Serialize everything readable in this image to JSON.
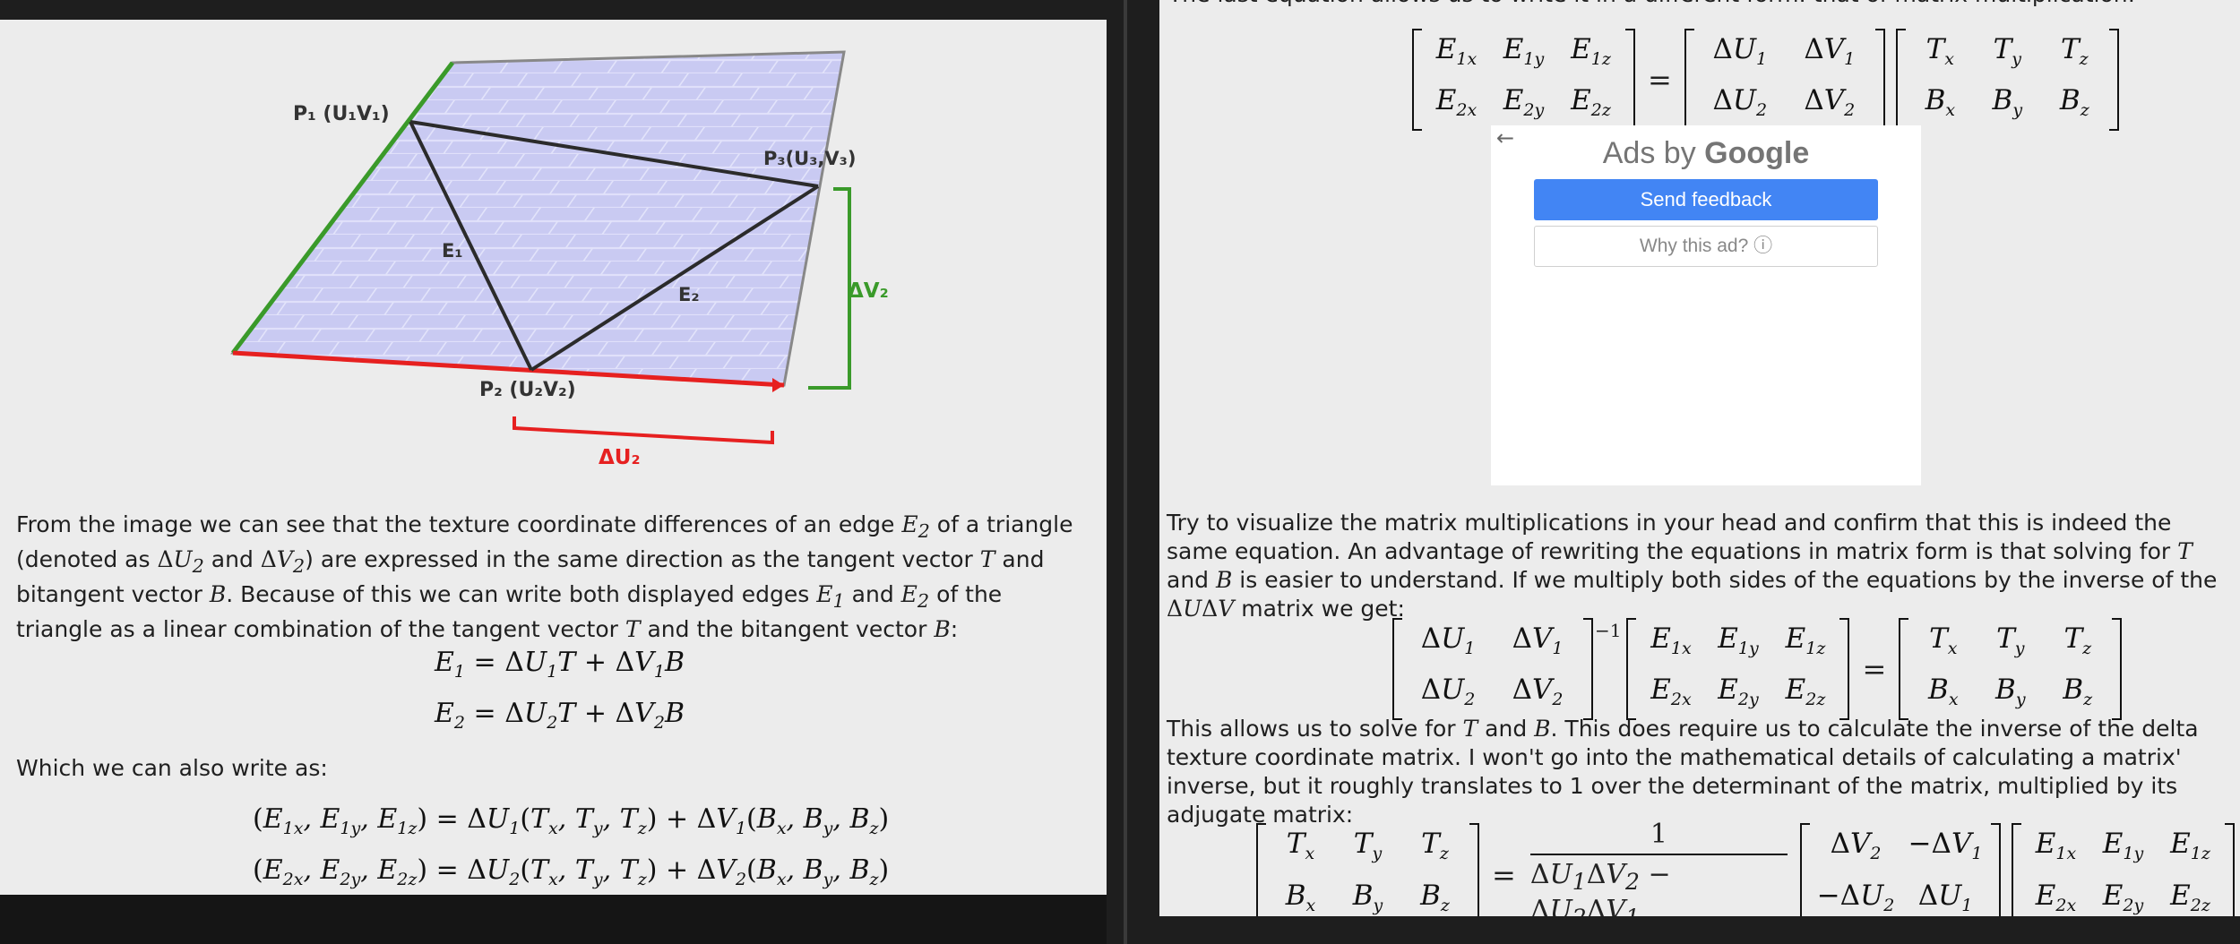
{
  "left": {
    "diagram": {
      "p1_label": "P₁ (U₁V₁)",
      "p2_label": "P₂ (U₂V₂)",
      "p3_label": "P₃(U₃,V₃)",
      "e1_label": "E₁",
      "e2_label": "E₂",
      "dv2_label": "ΔV₂",
      "du2_label": "ΔU₂",
      "colors": {
        "green": "#3a9a2a",
        "red": "#e62020",
        "plane": "#c9caf2",
        "edge": "#2b2b2b"
      }
    },
    "para1": {
      "t1": "From the image we can see that the texture coordinate differences of an edge ",
      "t2": " of a triangle (denoted as ",
      "t3": " and ",
      "t4": ") are expressed in the same direction as the tangent vector ",
      "t5": " and bitangent vector ",
      "t6": ". Because of this we can write both displayed edges ",
      "t7": " and ",
      "t8": " of the triangle as a linear combination of the tangent vector ",
      "t9": " and the bitangent vector ",
      "t10": ":"
    },
    "para2": "Which we can also write as:"
  },
  "right": {
    "top_cut_text": "The last equation allows us to write it in a different form: that of matrix multiplication:",
    "ad": {
      "back_icon": "←",
      "title_prefix": "Ads by ",
      "title_brand": "Google",
      "send_feedback": "Send feedback",
      "why_ad": "Why this ad? ⓘ"
    },
    "para1": {
      "t1": "Try to visualize the matrix multiplications in your head and confirm that this is indeed the same equation. An advantage of rewriting the equations in matrix form is that solving for ",
      "t2": " and ",
      "t3": " is easier to understand. If we multiply both sides of the equations by the inverse of the ",
      "t4": " matrix we get:"
    },
    "para2": {
      "t1": "This allows us to solve for ",
      "t2": " and ",
      "t3": ". This does require us to calculate the inverse of the delta texture coordinate matrix. I won't go into the mathematical details of calculating a matrix' inverse, but it roughly translates to 1 over the determinant of the matrix, multiplied by its adjugate matrix:"
    },
    "frac_numerator": "1"
  }
}
